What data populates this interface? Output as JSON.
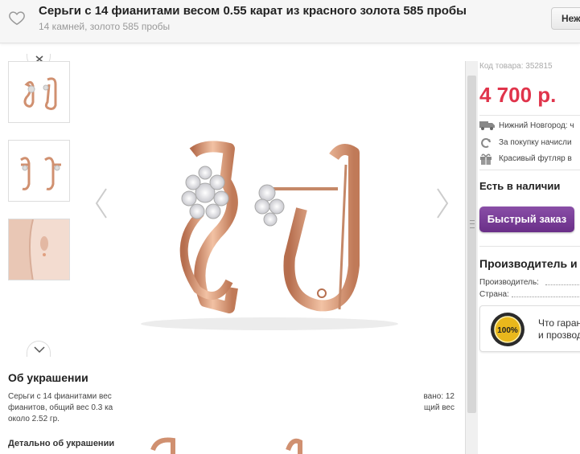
{
  "header": {
    "title": "Серьги с 14 фианитами весом 0.55 карат из красного золота 585 пробы",
    "subtitle": "14 камней, золото 585 пробы",
    "button_label": "Неж"
  },
  "gallery": {
    "thumbnails": [
      "thumbnail-earrings-side",
      "thumbnail-earrings-front",
      "thumbnail-earring-on-model"
    ]
  },
  "about": {
    "title": "Об украшении",
    "text_left": "Серьги с 14 фианитами вес фианитов, общий вес 0.3 ка около 2.52 гр.",
    "text_right": "вано: 12 щий вес",
    "detail_title": "Детально об украшении"
  },
  "product": {
    "code": "Код товара: 352815",
    "price": "4 700 р.",
    "delivery": "Нижний Новгород: ч",
    "bonus": "За покупку начисли",
    "gift": "Красивый футляр в",
    "stock": "Есть в наличии",
    "quick_order": "Быстрый заказ"
  },
  "maker": {
    "title": "Производитель и",
    "manufacturer_label": "Производитель:",
    "country_label": "Страна:"
  },
  "guarantee": {
    "line1": "Что гаран",
    "line2": "и прозвод",
    "seal_text": "100%"
  },
  "colors": {
    "price": "#e0344b",
    "button": "#7a3f98",
    "gold": "#d99a7a"
  }
}
